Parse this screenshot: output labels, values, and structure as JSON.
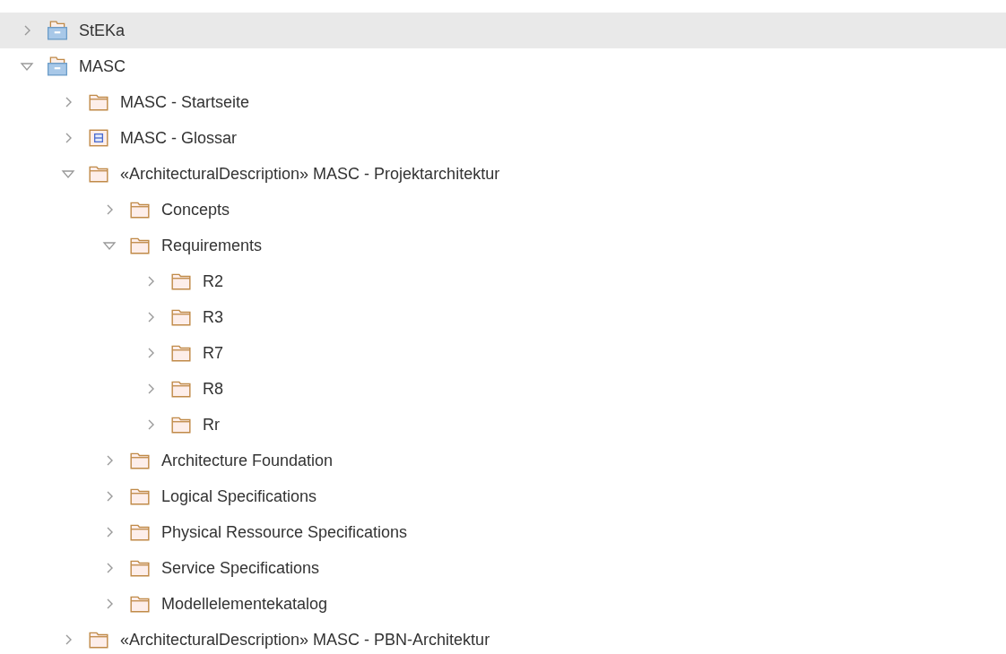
{
  "tree": [
    {
      "label": "StEKa",
      "kind": "package",
      "expanded": false,
      "selected": true
    },
    {
      "label": "MASC",
      "kind": "package",
      "expanded": true,
      "selected": false,
      "children": [
        {
          "label": "MASC - Startseite",
          "kind": "folder",
          "expanded": false,
          "selected": false
        },
        {
          "label": "MASC - Glossar",
          "kind": "glossary",
          "expanded": false,
          "selected": false
        },
        {
          "label": "«ArchitecturalDescription» MASC - Projektarchitektur",
          "kind": "folder",
          "expanded": true,
          "selected": false,
          "children": [
            {
              "label": "Concepts",
              "kind": "folder",
              "expanded": false,
              "selected": false
            },
            {
              "label": "Requirements",
              "kind": "folder",
              "expanded": true,
              "selected": false,
              "children": [
                {
                  "label": "R2",
                  "kind": "folder",
                  "expanded": false,
                  "selected": false
                },
                {
                  "label": "R3",
                  "kind": "folder",
                  "expanded": false,
                  "selected": false
                },
                {
                  "label": "R7",
                  "kind": "folder",
                  "expanded": false,
                  "selected": false
                },
                {
                  "label": "R8",
                  "kind": "folder",
                  "expanded": false,
                  "selected": false
                },
                {
                  "label": "Rr",
                  "kind": "folder",
                  "expanded": false,
                  "selected": false
                }
              ]
            },
            {
              "label": "Architecture Foundation",
              "kind": "folder",
              "expanded": false,
              "selected": false
            },
            {
              "label": "Logical Specifications",
              "kind": "folder",
              "expanded": false,
              "selected": false
            },
            {
              "label": "Physical Ressource Specifications",
              "kind": "folder",
              "expanded": false,
              "selected": false
            },
            {
              "label": "Service Specifications",
              "kind": "folder",
              "expanded": false,
              "selected": false
            },
            {
              "label": "Modellelementekatalog",
              "kind": "folder",
              "expanded": false,
              "selected": false
            }
          ]
        },
        {
          "label": "«ArchitecturalDescription» MASC - PBN-Architektur",
          "kind": "folder",
          "expanded": false,
          "selected": false
        }
      ]
    }
  ]
}
